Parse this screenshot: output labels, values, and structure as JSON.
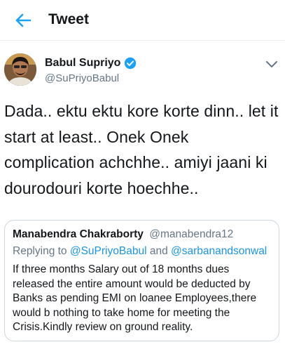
{
  "header": {
    "title": "Tweet",
    "back_icon": "back-arrow-icon",
    "accent": "#1da1f2"
  },
  "tweet": {
    "author_name": "Babul Supriyo",
    "author_handle": "@SuPriyoBabul",
    "verified": true,
    "text": "Dada.. ektu ektu kore korte dinn.. let it start at least.. Onek Onek complication achchhe.. amiyi jaani ki dourodouri korte hoechhe..",
    "menu_icon": "chevron-down-icon"
  },
  "quoted_tweet": {
    "author_name": "Manabendra Chakraborty",
    "author_handle": "@manabendra12",
    "replying_prefix": "Replying to",
    "replying_to_1": "@SuPriyoBabul",
    "replying_and": "and",
    "replying_to_2": "@sarbanandsonwal",
    "text": "If three months Salary out of 18 months dues released the entire amount would be deducted by Banks as pending EMI on loanee Employees,there would b nothing to take home for meeting the Crisis.Kindly review on ground reality."
  }
}
